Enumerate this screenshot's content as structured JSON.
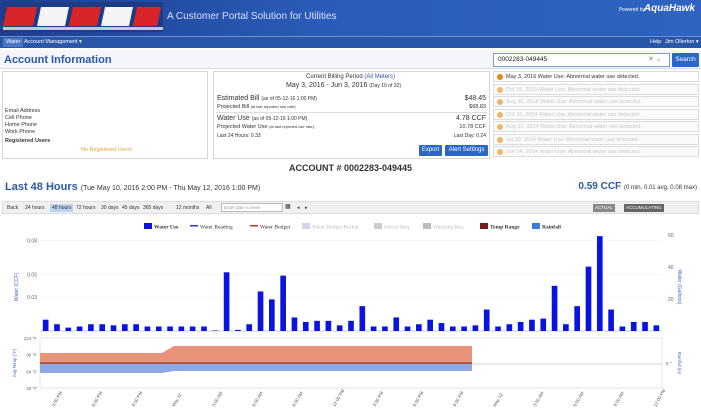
{
  "header": {
    "tagline": "A Customer Portal Solution for Utilities",
    "powered_by": "Powered by",
    "brand": "AquaHawk"
  },
  "nav": {
    "water": "Water",
    "account_mgmt": "Account Management ▾",
    "help": "Help",
    "user": "Jim Ollerton ▾"
  },
  "section": {
    "title": "Account Information"
  },
  "search": {
    "value": "0002283-049445",
    "clear": "✕ ⌄",
    "button": "Search"
  },
  "contact": {
    "email": "Email Address",
    "cell": "Cell Phone",
    "home": "Home Phone",
    "work": "Work Phone",
    "registered": "Registered Users",
    "no_registered": "No Registered Users"
  },
  "billing": {
    "period_label": "Current Billing Period",
    "all_meters": "(All Meters)",
    "period": "May 3, 2016 - Jun 3, 2016",
    "day": "(Day 10 of 32)",
    "est_label": "Estimated Bill",
    "est_asof": "(as of 05-12-16 1:00 PM)",
    "est_value": "$48.45",
    "proj_label": "Projected Bill",
    "proj_note": "(at last reported use rate)",
    "proj_value": "$68.83",
    "use_label": "Water Use",
    "use_asof": "(as of 05-12-16 1:00 PM)",
    "use_value": "4.78 CCF",
    "pwu_label": "Projected Water Use",
    "pwu_note": "(at last reported use rate)",
    "pwu_value": "10.78 CCF",
    "l24": "Last 24 Hours: 0.33",
    "lastday": "Last Day: 0.24",
    "export": "Export",
    "alert_settings": "Alert Settings"
  },
  "alerts": [
    {
      "date": "May 3, 2016",
      "text": "Water Use: Abnormal water use detected.",
      "active": true
    },
    {
      "date": "Oct 15, 2015",
      "text": "Water Use: Abnormal water use detected.",
      "active": false
    },
    {
      "date": "Aug 30, 2015",
      "text": "Water Use: Abnormal water use detected.",
      "active": false
    },
    {
      "date": "Oct 15, 2014",
      "text": "Water Use: Abnormal water use detected.",
      "active": false
    },
    {
      "date": "Aug 12, 2014",
      "text": "Water Use: Abnormal water use detected.",
      "active": false
    },
    {
      "date": "Jul 20, 2014",
      "text": "Water Use: Abnormal water use detected.",
      "active": false
    },
    {
      "date": "Jun 14, 2014",
      "text": "Water Use: Abnormal water use detected.",
      "active": false
    }
  ],
  "account": {
    "label": "ACCOUNT # 0002283-049445"
  },
  "range": {
    "title": "Last 48 Hours",
    "dates": "(Tue May 10, 2016 2:00 PM - Thu May 12, 2016 1:00 PM)",
    "total": "0.59 CCF",
    "stats": "(0 min, 0.01 avg, 0.08 max)"
  },
  "toolbar": {
    "items": [
      "Back",
      "24 hours",
      "48 hours",
      "72 hours",
      "30 days",
      "45 days",
      "365 days",
      "12 months",
      "All"
    ],
    "selected": "48 hours",
    "date_placeholder": "Enter date to view",
    "actual": "ACTUAL",
    "accumulating": "ACCUMULATING"
  },
  "chart_data": {
    "type": "bar",
    "legend": [
      "Water Use",
      "Water Reading",
      "Water Budget",
      "Water Budget Rollup",
      "Indoor Req",
      "Watering Req",
      "Temp Range",
      "Rainfall"
    ],
    "ylabel_left": "Water (CCF)",
    "ylabel_right": "Water (Gallons)",
    "yticks_left": [
      "0.08",
      "0.05",
      "0.03"
    ],
    "yticks_right": [
      "60",
      "40",
      "20"
    ],
    "values": [
      0.01,
      0.006,
      0.003,
      0.004,
      0.006,
      0.006,
      0.005,
      0.006,
      0.006,
      0.004,
      0.004,
      0.004,
      0.004,
      0.004,
      0.004,
      0.0005,
      0.052,
      0.001,
      0.006,
      0.035,
      0.028,
      0.049,
      0.012,
      0.008,
      0.009,
      0.009,
      0.005,
      0.009,
      0.022,
      0.004,
      0.004,
      0.012,
      0.004,
      0.006,
      0.01,
      0.007,
      0.004,
      0.004,
      0.005,
      0.019,
      0.004,
      0.006,
      0.008,
      0.01,
      0.011,
      0.04,
      0.006,
      0.022,
      0.057,
      0.084,
      0.019,
      0.004,
      0.008,
      0.008,
      0.005
    ],
    "temp": {
      "ylabel": "Avg Temp (°F)",
      "yticks": [
        "124 °F",
        "96 °F",
        "64 °F",
        "32 °F"
      ],
      "rain_label": "Rainfall (in)",
      "rain_tick": "0 \""
    },
    "xticks": [
      "3:00 PM",
      "6:00 PM",
      "9:00 PM",
      "May 11",
      "3:00 AM",
      "6:00 AM",
      "9:00 AM",
      "12:00 PM",
      "3:00 PM",
      "6:00 PM",
      "9:00 PM",
      "May 12",
      "3:00 AM",
      "6:00 AM",
      "9:00 AM",
      "12:00 PM"
    ],
    "colors": {
      "bar": "#0a14e0",
      "temp_high": "#e9927a",
      "temp_low": "#8ea9e6",
      "temp_line": "#7b1a1a"
    }
  }
}
